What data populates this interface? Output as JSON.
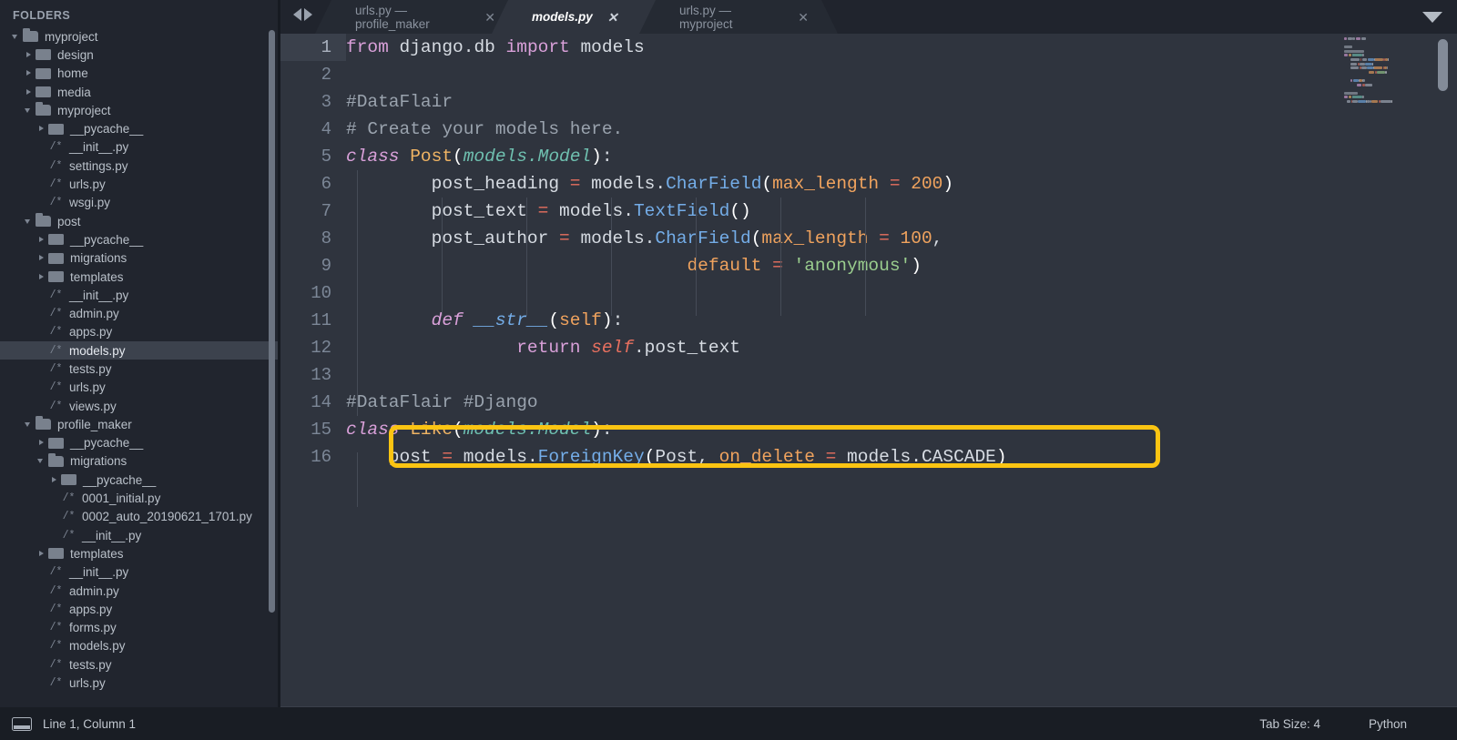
{
  "sidebar": {
    "header": "FOLDERS",
    "items": [
      {
        "label": "myproject",
        "type": "folder",
        "state": "open",
        "depth": 0
      },
      {
        "label": "design",
        "type": "folder",
        "state": "closed",
        "depth": 1
      },
      {
        "label": "home",
        "type": "folder",
        "state": "closed",
        "depth": 1
      },
      {
        "label": "media",
        "type": "folder",
        "state": "closed",
        "depth": 1
      },
      {
        "label": "myproject",
        "type": "folder",
        "state": "open",
        "depth": 1
      },
      {
        "label": "__pycache__",
        "type": "folder",
        "state": "closed",
        "depth": 2
      },
      {
        "label": "__init__.py",
        "type": "file",
        "depth": 2
      },
      {
        "label": "settings.py",
        "type": "file",
        "depth": 2
      },
      {
        "label": "urls.py",
        "type": "file",
        "depth": 2
      },
      {
        "label": "wsgi.py",
        "type": "file",
        "depth": 2
      },
      {
        "label": "post",
        "type": "folder",
        "state": "open",
        "depth": 1
      },
      {
        "label": "__pycache__",
        "type": "folder",
        "state": "closed",
        "depth": 2
      },
      {
        "label": "migrations",
        "type": "folder",
        "state": "closed",
        "depth": 2
      },
      {
        "label": "templates",
        "type": "folder",
        "state": "closed",
        "depth": 2
      },
      {
        "label": "__init__.py",
        "type": "file",
        "depth": 2
      },
      {
        "label": "admin.py",
        "type": "file",
        "depth": 2
      },
      {
        "label": "apps.py",
        "type": "file",
        "depth": 2
      },
      {
        "label": "models.py",
        "type": "file",
        "depth": 2,
        "selected": true
      },
      {
        "label": "tests.py",
        "type": "file",
        "depth": 2
      },
      {
        "label": "urls.py",
        "type": "file",
        "depth": 2
      },
      {
        "label": "views.py",
        "type": "file",
        "depth": 2
      },
      {
        "label": "profile_maker",
        "type": "folder",
        "state": "open",
        "depth": 1
      },
      {
        "label": "__pycache__",
        "type": "folder",
        "state": "closed",
        "depth": 2
      },
      {
        "label": "migrations",
        "type": "folder",
        "state": "open",
        "depth": 2
      },
      {
        "label": "__pycache__",
        "type": "folder",
        "state": "closed",
        "depth": 3
      },
      {
        "label": "0001_initial.py",
        "type": "file",
        "depth": 3
      },
      {
        "label": "0002_auto_20190621_1701.py",
        "type": "file",
        "depth": 3
      },
      {
        "label": "__init__.py",
        "type": "file",
        "depth": 3
      },
      {
        "label": "templates",
        "type": "folder",
        "state": "closed",
        "depth": 2
      },
      {
        "label": "__init__.py",
        "type": "file",
        "depth": 2
      },
      {
        "label": "admin.py",
        "type": "file",
        "depth": 2
      },
      {
        "label": "apps.py",
        "type": "file",
        "depth": 2
      },
      {
        "label": "forms.py",
        "type": "file",
        "depth": 2
      },
      {
        "label": "models.py",
        "type": "file",
        "depth": 2
      },
      {
        "label": "tests.py",
        "type": "file",
        "depth": 2
      },
      {
        "label": "urls.py",
        "type": "file",
        "depth": 2
      }
    ],
    "file_icon_glyph": "/*"
  },
  "tabs": {
    "prev_icon": "nav-prev-icon",
    "next_icon": "nav-next-icon",
    "close_glyph": "✕",
    "items": [
      {
        "label": "urls.py — profile_maker",
        "active": false
      },
      {
        "label": "models.py",
        "active": true
      },
      {
        "label": "urls.py — myproject",
        "active": false
      }
    ],
    "menu_caret": "chevron-down-icon"
  },
  "editor": {
    "language_mode": "Python",
    "active_line": 1,
    "line_numbers": [
      "1",
      "2",
      "3",
      "4",
      "5",
      "6",
      "7",
      "8",
      "9",
      "10",
      "11",
      "12",
      "13",
      "14",
      "15",
      "16"
    ],
    "lines": [
      {
        "n": 1,
        "tokens": [
          {
            "t": "from",
            "c": "kw2"
          },
          {
            "t": " django",
            "c": "plain"
          },
          {
            "t": ".",
            "c": "plain"
          },
          {
            "t": "db ",
            "c": "plain"
          },
          {
            "t": "import",
            "c": "kw2"
          },
          {
            "t": " models",
            "c": "plain"
          }
        ]
      },
      {
        "n": 2,
        "tokens": []
      },
      {
        "n": 3,
        "tokens": [
          {
            "t": "#DataFlair",
            "c": "cmt"
          }
        ]
      },
      {
        "n": 4,
        "tokens": [
          {
            "t": "# Create your models here.",
            "c": "cmt"
          }
        ]
      },
      {
        "n": 5,
        "tokens": [
          {
            "t": "class",
            "c": "kw"
          },
          {
            "t": " ",
            "c": "plain"
          },
          {
            "t": "Post",
            "c": "cls"
          },
          {
            "t": "(",
            "c": "punct"
          },
          {
            "t": "models.Model",
            "c": "typ"
          },
          {
            "t": ")",
            "c": "punct"
          },
          {
            "t": ":",
            "c": "plain"
          }
        ]
      },
      {
        "n": 6,
        "tokens": [
          {
            "t": "        post_heading ",
            "c": "plain"
          },
          {
            "t": "=",
            "c": "op"
          },
          {
            "t": " models.",
            "c": "plain"
          },
          {
            "t": "CharField",
            "c": "fn"
          },
          {
            "t": "(",
            "c": "punct"
          },
          {
            "t": "max_length",
            "c": "param"
          },
          {
            "t": " ",
            "c": "plain"
          },
          {
            "t": "=",
            "c": "op"
          },
          {
            "t": " ",
            "c": "plain"
          },
          {
            "t": "200",
            "c": "num"
          },
          {
            "t": ")",
            "c": "punct"
          }
        ]
      },
      {
        "n": 7,
        "tokens": [
          {
            "t": "        post_text ",
            "c": "plain"
          },
          {
            "t": "=",
            "c": "op"
          },
          {
            "t": " models.",
            "c": "plain"
          },
          {
            "t": "TextField",
            "c": "fn"
          },
          {
            "t": "()",
            "c": "punct"
          }
        ]
      },
      {
        "n": 8,
        "tokens": [
          {
            "t": "        post_author ",
            "c": "plain"
          },
          {
            "t": "=",
            "c": "op"
          },
          {
            "t": " models.",
            "c": "plain"
          },
          {
            "t": "CharField",
            "c": "fn"
          },
          {
            "t": "(",
            "c": "punct"
          },
          {
            "t": "max_length",
            "c": "param"
          },
          {
            "t": " ",
            "c": "plain"
          },
          {
            "t": "=",
            "c": "op"
          },
          {
            "t": " ",
            "c": "plain"
          },
          {
            "t": "100",
            "c": "num"
          },
          {
            "t": ",",
            "c": "plain"
          }
        ]
      },
      {
        "n": 9,
        "tokens": [
          {
            "t": "                                ",
            "c": "plain"
          },
          {
            "t": "default",
            "c": "param"
          },
          {
            "t": " ",
            "c": "plain"
          },
          {
            "t": "=",
            "c": "op"
          },
          {
            "t": " ",
            "c": "plain"
          },
          {
            "t": "'anonymous'",
            "c": "str"
          },
          {
            "t": ")",
            "c": "punct"
          }
        ]
      },
      {
        "n": 10,
        "tokens": []
      },
      {
        "n": 11,
        "tokens": [
          {
            "t": "        ",
            "c": "plain"
          },
          {
            "t": "def",
            "c": "kw"
          },
          {
            "t": " ",
            "c": "plain"
          },
          {
            "t": "__str__",
            "c": "fni"
          },
          {
            "t": "(",
            "c": "punct"
          },
          {
            "t": "self",
            "c": "param"
          },
          {
            "t": ")",
            "c": "punct"
          },
          {
            "t": ":",
            "c": "plain"
          }
        ]
      },
      {
        "n": 12,
        "tokens": [
          {
            "t": "                ",
            "c": "plain"
          },
          {
            "t": "return",
            "c": "kw2"
          },
          {
            "t": " ",
            "c": "plain"
          },
          {
            "t": "self",
            "c": "selfk"
          },
          {
            "t": ".post_text",
            "c": "plain"
          }
        ]
      },
      {
        "n": 13,
        "tokens": []
      },
      {
        "n": 14,
        "tokens": [
          {
            "t": "#DataFlair #Django",
            "c": "cmt"
          }
        ]
      },
      {
        "n": 15,
        "tokens": [
          {
            "t": "class",
            "c": "kw"
          },
          {
            "t": " ",
            "c": "plain"
          },
          {
            "t": "Like",
            "c": "cls"
          },
          {
            "t": "(",
            "c": "punct"
          },
          {
            "t": "models.Model",
            "c": "typ"
          },
          {
            "t": ")",
            "c": "punct"
          },
          {
            "t": ":",
            "c": "plain"
          }
        ]
      },
      {
        "n": 16,
        "tokens": [
          {
            "t": "    post ",
            "c": "plain"
          },
          {
            "t": "=",
            "c": "op"
          },
          {
            "t": " models.",
            "c": "plain"
          },
          {
            "t": "ForeignKey",
            "c": "fn"
          },
          {
            "t": "(",
            "c": "punct"
          },
          {
            "t": "Post",
            "c": "plain"
          },
          {
            "t": ", ",
            "c": "plain"
          },
          {
            "t": "on_delete",
            "c": "param"
          },
          {
            "t": " ",
            "c": "plain"
          },
          {
            "t": "=",
            "c": "op"
          },
          {
            "t": " models.CASCADE",
            "c": "plain"
          },
          {
            "t": ")",
            "c": "punct"
          }
        ]
      }
    ],
    "highlight_color": "#fbc412"
  },
  "statusbar": {
    "position_icon": "panel-toggle-icon",
    "position": "Line 1, Column 1",
    "tab_size": "Tab Size: 4",
    "language": "Python"
  },
  "colors": {
    "editor_bg": "#2f343e",
    "sidebar_bg": "#21252e",
    "tabbar_bg": "#20242d",
    "statusbar_bg": "#191d24",
    "accent_highlight": "#fbc412",
    "selection_bg": "#3c424d"
  }
}
